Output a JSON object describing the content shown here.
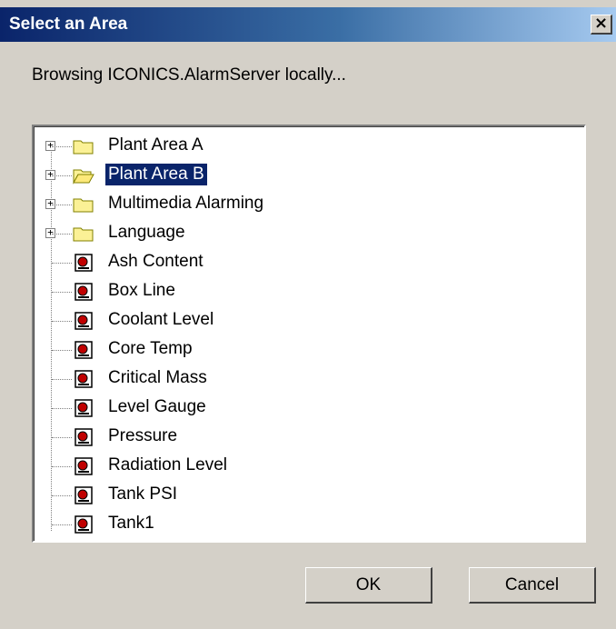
{
  "dialog": {
    "title": "Select an Area",
    "close_label": "×",
    "status_text": "Browsing ICONICS.AlarmServer locally...",
    "colors": {
      "title_bar": "#0a246a",
      "selection": "#0a246a",
      "face": "#d4d0c8"
    }
  },
  "tree": {
    "areas": [
      {
        "label": "Plant Area A",
        "icon": "folder-icon",
        "expander": "+",
        "selected": false
      },
      {
        "label": "Plant Area B",
        "icon": "folder-open-icon",
        "expander": "+",
        "selected": true
      },
      {
        "label": "Multimedia Alarming",
        "icon": "folder-icon",
        "expander": "+",
        "selected": false
      },
      {
        "label": "Language",
        "icon": "folder-icon",
        "expander": "+",
        "selected": false
      }
    ],
    "tags": [
      {
        "label": "Ash Content",
        "icon": "alarm-tag-icon"
      },
      {
        "label": "Box Line",
        "icon": "alarm-tag-icon"
      },
      {
        "label": "Coolant Level",
        "icon": "alarm-tag-icon"
      },
      {
        "label": "Core Temp",
        "icon": "alarm-tag-icon"
      },
      {
        "label": "Critical Mass",
        "icon": "alarm-tag-icon"
      },
      {
        "label": "Level Gauge",
        "icon": "alarm-tag-icon"
      },
      {
        "label": "Pressure",
        "icon": "alarm-tag-icon"
      },
      {
        "label": "Radiation Level",
        "icon": "alarm-tag-icon"
      },
      {
        "label": "Tank PSI",
        "icon": "alarm-tag-icon"
      },
      {
        "label": "Tank1",
        "icon": "alarm-tag-icon"
      }
    ]
  },
  "buttons": {
    "ok_label": "OK",
    "cancel_label": "Cancel"
  }
}
